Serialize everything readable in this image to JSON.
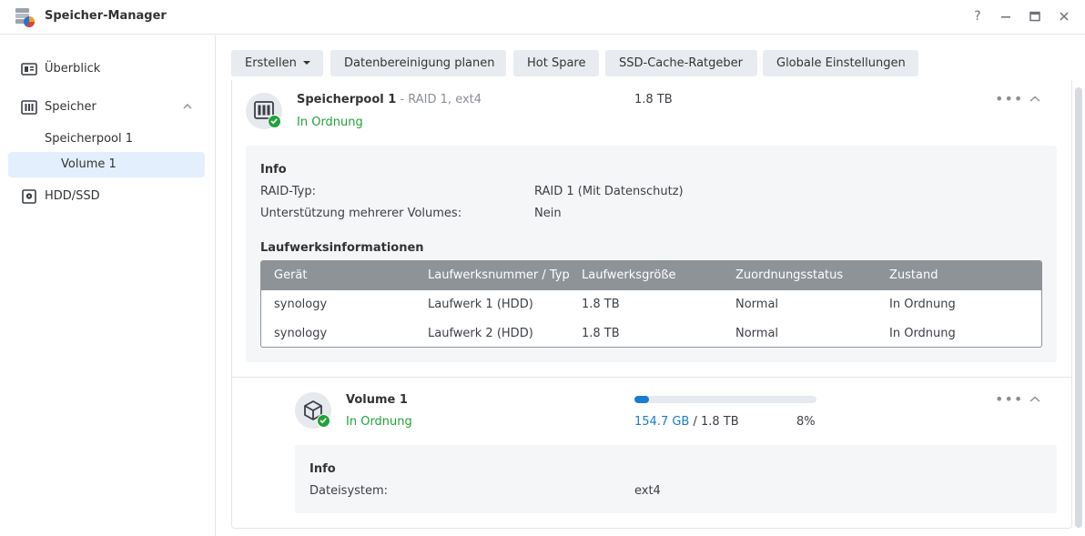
{
  "window": {
    "title": "Speicher-Manager",
    "controls": {
      "help": "?",
      "minimize": "—",
      "maximize": "▭",
      "close": "✕"
    }
  },
  "sidebar": {
    "overview": "Überblick",
    "storage": "Speicher",
    "pool": "Speicherpool 1",
    "volume": "Volume 1",
    "hdd": "HDD/SSD"
  },
  "toolbar": {
    "create": "Erstellen",
    "scrub": "Datenbereinigung planen",
    "hotspare": "Hot Spare",
    "ssd_cache": "SSD-Cache-Ratgeber",
    "global_settings": "Globale Einstellungen"
  },
  "pool": {
    "name": "Speicherpool 1",
    "details": " - RAID 1, ext4",
    "size": "1.8 TB",
    "status": "In Ordnung",
    "info_title": "Info",
    "raid_label": "RAID-Typ:",
    "raid_value": "RAID 1 (Mit Datenschutz)",
    "multi_label": "Unterstützung mehrerer Volumes:",
    "multi_value": "Nein",
    "drives_title": "Laufwerksinformationen",
    "columns": [
      "Gerät",
      "Laufwerksnummer / Typ",
      "Laufwerksgröße",
      "Zuordnungsstatus",
      "Zustand"
    ],
    "drives": [
      {
        "device": "synology",
        "number": "Laufwerk 1 (HDD)",
        "size": "1.8 TB",
        "allocation": "Normal",
        "state": "In Ordnung"
      },
      {
        "device": "synology",
        "number": "Laufwerk 2 (HDD)",
        "size": "1.8 TB",
        "allocation": "Normal",
        "state": "In Ordnung"
      }
    ]
  },
  "volume": {
    "name": "Volume 1",
    "status": "In Ordnung",
    "used": "154.7 GB",
    "total": " / 1.8 TB",
    "percent": "8%",
    "usage_fraction": 0.08,
    "info_title": "Info",
    "fs_label": "Dateisystem:",
    "fs_value": "ext4"
  },
  "colors": {
    "accent": "#1a7ccf",
    "ok": "#21a33b",
    "header": "#8e9398"
  }
}
